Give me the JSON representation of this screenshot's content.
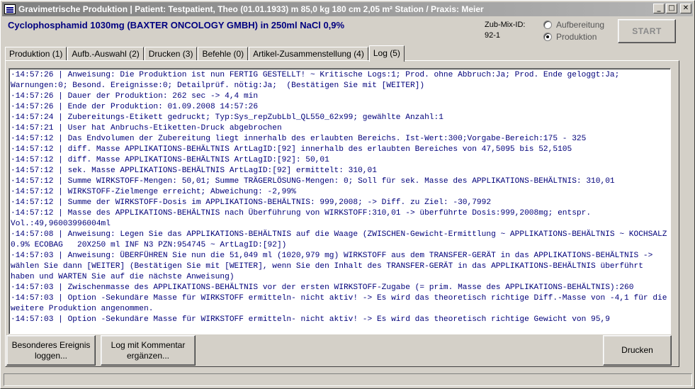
{
  "window": {
    "title": "Gravimetrische Produktion  |  Patient: Testpatient, Theo (01.01.1933) m 85,0 kg  180 cm  2,05 m² Station / Praxis: Meier",
    "controls": {
      "minimize": "_",
      "maximize": "□",
      "close": "✕"
    }
  },
  "header": {
    "product": "Cyclophosphamid 1030mg (BAXTER ONCOLOGY GMBH) in 250ml NaCl 0,9%",
    "zub_mix_label": "Zub-Mix-ID:",
    "zub_mix_value": "92-1",
    "radio_options": [
      {
        "label": "Aufbereitung",
        "checked": false
      },
      {
        "label": "Produktion",
        "checked": true
      }
    ],
    "start_label": "START"
  },
  "tabs": [
    {
      "label": "Produktion (1)",
      "active": false
    },
    {
      "label": "Aufb.-Auswahl (2)",
      "active": false
    },
    {
      "label": "Drucken (3)",
      "active": false
    },
    {
      "label": "Befehle (0)",
      "active": false
    },
    {
      "label": "Artikel-Zusammenstellung (4)",
      "active": false
    },
    {
      "label": "Log (5)",
      "active": true
    }
  ],
  "log": [
    "·14:57:26 | Anweisung: Die Produktion ist nun FERTIG GESTELLT! ~ Kritische Logs:1; Prod. ohne Abbruch:Ja; Prod. Ende geloggt:Ja; Warnungen:0; Besond. Ereignisse:0; Detailprüf. nötig:Ja;  (Bestätigen Sie mit [WEITER])",
    "·14:57:26 | Dauer der Produktion: 262 sec -> 4,4 min",
    "·14:57:26 | Ende der Produktion: 01.09.2008 14:57:26",
    "·14:57:24 | Zubereitungs-Etikett gedruckt; Typ:Sys_repZubLbl_QL550_62x99; gewählte Anzahl:1",
    "·14:57:21 | User hat Anbruchs-Etiketten-Druck abgebrochen",
    "·14:57:12 | Das Endvolumen der Zubereitung liegt innerhalb des erlaubten Bereichs. Ist-Wert:300;Vorgabe-Bereich:175 - 325",
    "·14:57:12 | diff. Masse APPLIKATIONS-BEHÄLTNIS ArtLagID:[92] innerhalb des erlaubten Bereiches von 47,5095 bis 52,5105",
    "·14:57:12 | diff. Masse APPLIKATIONS-BEHÄLTNIS ArtLagID:[92]: 50,01",
    "·14:57:12 | sek. Masse APPLIKATIONS-BEHÄLTNIS ArtLagID:[92] ermittelt: 310,01",
    "·14:57:12 | Summe WIRKSTOFF-Mengen: 50,01; Summe TRÄGERLÖSUNG-Mengen: 0; Soll für sek. Masse des APPLIKATIONS-BEHÄLTNIS: 310,01",
    "·14:57:12 | WIRKSTOFF-Zielmenge erreicht; Abweichung: -2,99%",
    "·14:57:12 | Summe der WIRKSTOFF-Dosis im APPLIKATIONS-BEHÄLTNIS: 999,2008; -> Diff. zu Ziel: -30,7992",
    "·14:57:12 | Masse des APPLIKATIONS-BEHÄLTNIS nach Überführung von WIRKSTOFF:310,01 -> überführte Dosis:999,2008mg; entspr. Vol.:49,96003996004ml",
    "·14:57:08 | Anweisung: Legen Sie das APPLIKATIONS-BEHÄLTNIS auf die Waage (ZWISCHEN-Gewicht-Ermittlung ~ APPLIKATIONS-BEHÄLTNIS ~ KOCHSALZ 0.9% ECOBAG   20X250 ml INF N3 PZN:954745 ~ ArtLagID:[92])",
    "·14:57:03 | Anweisung: ÜBERFÜHREN Sie nun die 51,049 ml (1020,979 mg) WIRKSTOFF aus dem TRANSFER-GERÄT in das APPLIKATIONS-BEHÄLTNIS -> wählen Sie dann [WEITER] (Bestätigen Sie mit [WEITER], wenn Sie den Inhalt des TRANSFER-GERÄT in das APPLIKATIONS-BEHÄLTNIS überführt haben und WARTEN Sie auf die nächste Anweisung)",
    "·14:57:03 | Zwischenmasse des APPLIKATIONS-BEHÄLTNIS vor der ersten WIRKSTOFF-Zugabe (= prim. Masse des APPLIKATIONS-BEHÄLTNIS):260",
    "·14:57:03 | Option -Sekundäre Masse für WIRKSTOFF ermitteln- nicht aktiv! -> Es wird das theoretisch richtige Diff.-Masse von -4,1 für die weitere Produktion angenommen.",
    "·14:57:03 | Option -Sekundäre Masse für WIRKSTOFF ermitteln- nicht aktiv! -> Es wird das theoretisch richtige Gewicht von 95,9"
  ],
  "buttons": {
    "ereignis": "Besonderes Ereignis loggen...",
    "kommentar": "Log mit Kommentar ergänzen...",
    "drucken": "Drucken"
  }
}
